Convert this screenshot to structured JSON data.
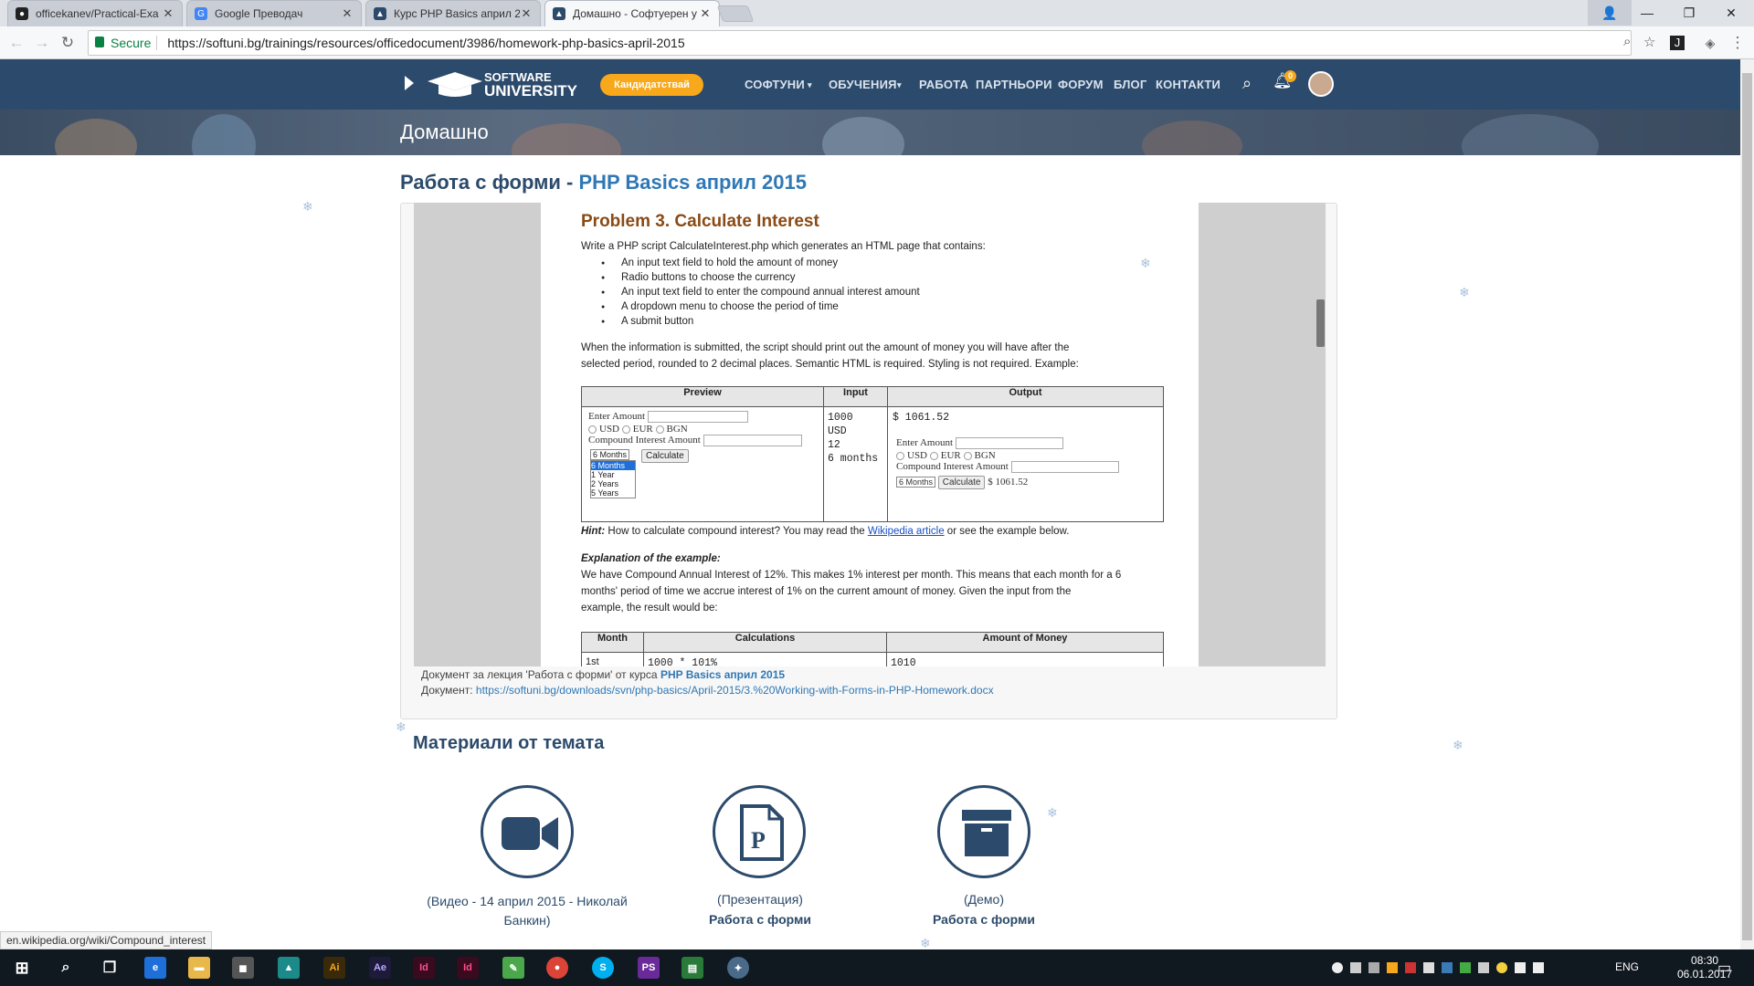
{
  "tabs": [
    {
      "title": "officekanev/Practical-Exa",
      "icon": "github-icon"
    },
    {
      "title": "Google Преводач",
      "icon": "google-translate-icon"
    },
    {
      "title": "Курс PHP Basics април 2",
      "icon": "softuni-icon"
    },
    {
      "title": "Домашно - Софтуерен у",
      "icon": "softuni-icon"
    }
  ],
  "toolbar": {
    "secure_label": "Secure",
    "url": "https://softuni.bg/trainings/resources/officedocument/3986/homework-php-basics-april-2015"
  },
  "site": {
    "logo_line1": "SOFTWARE",
    "logo_line2": "UNIVERSITY",
    "cta": "Кандидатствай",
    "nav": [
      "СОФТУНИ",
      "ОБУЧЕНИЯ",
      "РАБОТА",
      "ПАРТНЬОРИ",
      "ФОРУМ",
      "БЛОГ",
      "КОНТАКТИ"
    ],
    "notif_count": "0",
    "hero_title": "Домашно"
  },
  "page": {
    "title_prefix": "Работа с форми - ",
    "title_link": "PHP Basics април 2015"
  },
  "doc": {
    "problem_title": "Problem 3.  Calculate Interest",
    "intro": "Write a PHP script CalculateInterest.php which generates an HTML page that contains:",
    "bullets": [
      "An input text field to hold the amount of money",
      "Radio buttons to choose the currency",
      "An input text field to enter the compound annual interest amount",
      "A dropdown menu to choose the period of time",
      "A submit button"
    ],
    "para1_line1": "When the information is submitted, the script should print out the amount of money you will have after the",
    "para1_line2": "selected period, rounded to 2 decimal places. Semantic HTML is required. Styling is not required. Example:",
    "table_headers": [
      "Preview",
      "Input",
      "Output"
    ],
    "preview": {
      "enter_amount": "Enter Amount",
      "currencies": [
        "USD",
        "EUR",
        "BGN"
      ],
      "compound_label": "Compound Interest Amount",
      "select_value": "6 Months",
      "options": [
        "6 Months",
        "1 Year",
        "2 Years",
        "5 Years"
      ],
      "calc_button": "Calculate"
    },
    "input_lines": [
      "1000",
      "USD",
      "12",
      "6 months"
    ],
    "output_value": "$ 1061.52",
    "output_result": "$ 1061.52",
    "hint_label": "Hint:",
    "hint_text": " How to calculate compound interest? You may read the ",
    "hint_link": "Wikipedia article",
    "hint_tail": " or see the example below.",
    "expl_title": "Explanation of the example:",
    "expl_lines": [
      "We have Compound Annual Interest of 12%. This makes 1% interest per month. This means that each month for a 6",
      "months' period of time we accrue interest of 1% on the current amount of money. Given the input from the",
      "example, the result would be:"
    ],
    "table2_headers": [
      "Month",
      "Calculations",
      "Amount of Money"
    ],
    "table2_row1": [
      "1st",
      "1000 * 101%",
      "1010"
    ]
  },
  "docmeta": {
    "line1_prefix": "Документ за лекция 'Работа с форми' от курса ",
    "line1_link": "PHP Basics април 2015",
    "line2_prefix": "Документ: ",
    "line2_link": "https://softuni.bg/downloads/svn/php-basics/April-2015/3.%20Working-with-Forms-in-PHP-Homework.docx"
  },
  "materials": {
    "title": "Материали от темата",
    "items": [
      {
        "caption": "(Видео - 14 април 2015 - Николай Банкин)",
        "name": "",
        "icon": "video-camera-icon"
      },
      {
        "caption": "(Презентация)",
        "name": "Работа с форми",
        "icon": "presentation-file-icon"
      },
      {
        "caption": "(Демо)",
        "name": "Работа с форми",
        "icon": "archive-box-icon"
      }
    ]
  },
  "status_url": "en.wikipedia.org/wiki/Compound_interest",
  "taskbar": {
    "lang": "ENG",
    "time": "08:30",
    "date": "06.01.2017"
  }
}
